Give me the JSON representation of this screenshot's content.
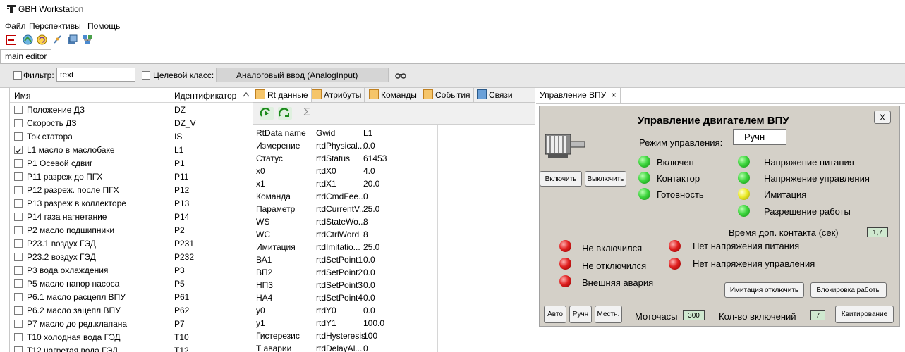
{
  "window": {
    "title": "GBH Workstation"
  },
  "menu": [
    "Файл",
    "Перспективы",
    "Помощь"
  ],
  "toolbar_icons": [
    "perspective-icon",
    "globe-icon",
    "refresh-icon",
    "connect-icon",
    "save-icon",
    "network-icon"
  ],
  "editor_tab": {
    "label": "main editor"
  },
  "filter": {
    "checkbox_label": "Фильтр:",
    "input_value": "text",
    "class_label": "Целевой класс:",
    "class_value": "Аналоговый ввод (AnalogInput)"
  },
  "left_table": {
    "headers": {
      "name": "Имя",
      "id": "Идентификатор"
    },
    "rows": [
      {
        "name": "Положение ДЗ",
        "id": "DZ",
        "checked": false
      },
      {
        "name": "Скорость ДЗ",
        "id": "DZ_V",
        "checked": false
      },
      {
        "name": "Ток статора",
        "id": "IS",
        "checked": false
      },
      {
        "name": "L1 масло в маслобаке",
        "id": "L1",
        "checked": true
      },
      {
        "name": "P1 Осевой сдвиг",
        "id": "P1",
        "checked": false
      },
      {
        "name": "P11 разреж до ПГХ",
        "id": "P11",
        "checked": false
      },
      {
        "name": "P12 разреж. после ПГХ",
        "id": "P12",
        "checked": false
      },
      {
        "name": "P13 разреж в коллекторе",
        "id": "P13",
        "checked": false
      },
      {
        "name": "P14 газа нагнетание",
        "id": "P14",
        "checked": false
      },
      {
        "name": "P2 масло подшипники",
        "id": "P2",
        "checked": false
      },
      {
        "name": "P23.1 воздух ГЭД",
        "id": "P231",
        "checked": false
      },
      {
        "name": "P23.2 воздух ГЭД",
        "id": "P232",
        "checked": false
      },
      {
        "name": "P3 вода охлаждения",
        "id": "P3",
        "checked": false
      },
      {
        "name": "P5 масло напор насоса",
        "id": "P5",
        "checked": false
      },
      {
        "name": "P6.1 масло расцепл ВПУ",
        "id": "P61",
        "checked": false
      },
      {
        "name": "P6.2 масло зацепл ВПУ",
        "id": "P62",
        "checked": false
      },
      {
        "name": "P7 масло до ред.клапана",
        "id": "P7",
        "checked": false
      },
      {
        "name": "T10 холодная вода ГЭД",
        "id": "T10",
        "checked": false
      },
      {
        "name": "T12 нагретая вода ГЭД",
        "id": "T12",
        "checked": false
      }
    ]
  },
  "mid_tabs": [
    "Rt данные",
    "Атрибуты",
    "Команды",
    "События",
    "Связи"
  ],
  "mid_toolbar": {
    "sigma": "Σ"
  },
  "rt_table": {
    "rows": [
      {
        "name": "RtData name",
        "gwid": "Gwid",
        "value": "L1"
      },
      {
        "name": "Измерение",
        "gwid": "rtdPhysical...",
        "value": "0.0"
      },
      {
        "name": "Статус",
        "gwid": "rtdStatus",
        "value": "61453"
      },
      {
        "name": "x0",
        "gwid": "rtdX0",
        "value": "4.0"
      },
      {
        "name": "x1",
        "gwid": "rtdX1",
        "value": "20.0"
      },
      {
        "name": "Команда",
        "gwid": "rtdCmdFee...",
        "value": "0"
      },
      {
        "name": "Параметр",
        "gwid": "rtdCurrentV...",
        "value": "25.0"
      },
      {
        "name": "WS",
        "gwid": "rtdStateWo...",
        "value": "8"
      },
      {
        "name": "WC",
        "gwid": "rtdCtrlWord",
        "value": "8"
      },
      {
        "name": "Имитация",
        "gwid": "rtdImitatio...",
        "value": "25.0"
      },
      {
        "name": "ВА1",
        "gwid": "rtdSetPoint1",
        "value": "0.0"
      },
      {
        "name": "ВП2",
        "gwid": "rtdSetPoint2",
        "value": "0.0"
      },
      {
        "name": "НП3",
        "gwid": "rtdSetPoint3",
        "value": "0.0"
      },
      {
        "name": "НА4",
        "gwid": "rtdSetPoint4",
        "value": "0.0"
      },
      {
        "name": "y0",
        "gwid": "rtdY0",
        "value": "0.0"
      },
      {
        "name": "y1",
        "gwid": "rtdY1",
        "value": "100.0"
      },
      {
        "name": "Гистерезис",
        "gwid": "rtdHysteresis",
        "value": "100"
      },
      {
        "name": "Т аварии",
        "gwid": "rtdDelayAl...",
        "value": "0"
      }
    ]
  },
  "right_tab": {
    "label": "Управление ВПУ",
    "close": "×"
  },
  "vpu": {
    "title": "Управление двигателем ВПУ",
    "close_button": "X",
    "mode_label": "Режим управления:",
    "mode_value": "Ручн",
    "btn_on": "Включить",
    "btn_off": "Выключить",
    "status_left": [
      {
        "label": "Включен",
        "color": "green"
      },
      {
        "label": "Контактор",
        "color": "green"
      },
      {
        "label": "Готовность",
        "color": "green"
      }
    ],
    "status_right": [
      {
        "label": "Напряжение питания",
        "color": "green"
      },
      {
        "label": "Напряжение управления",
        "color": "green"
      },
      {
        "label": "Имитация",
        "color": "yellow"
      },
      {
        "label": "Разрешение работы",
        "color": "green"
      }
    ],
    "contact_time_label": "Время доп. контакта (сек)",
    "contact_time_value": "1,7",
    "alarms_left": [
      {
        "label": "Не включился",
        "color": "red"
      },
      {
        "label": "Не отключился",
        "color": "red"
      },
      {
        "label": "Внешняя авария",
        "color": "red"
      }
    ],
    "alarms_right": [
      {
        "label": "Нет напряжения питания",
        "color": "red"
      },
      {
        "label": "Нет напряжения управления",
        "color": "red"
      }
    ],
    "btn_imitation_off": "Имитация отключить",
    "btn_block": "Блокировка работы",
    "btn_auto": "Авто",
    "btn_manual": "Ручн",
    "btn_local": "Местн.",
    "motor_hours_label": "Моточасы",
    "motor_hours_value": "300",
    "switch_count_label": "Кол-во включений",
    "switch_count_value": "7",
    "btn_ack": "Квитирование"
  },
  "colors": {
    "led_green": "#3ed63e",
    "led_yellow": "#ecec2a",
    "led_red": "#e02020",
    "panel_bg": "#d4d0c8"
  }
}
